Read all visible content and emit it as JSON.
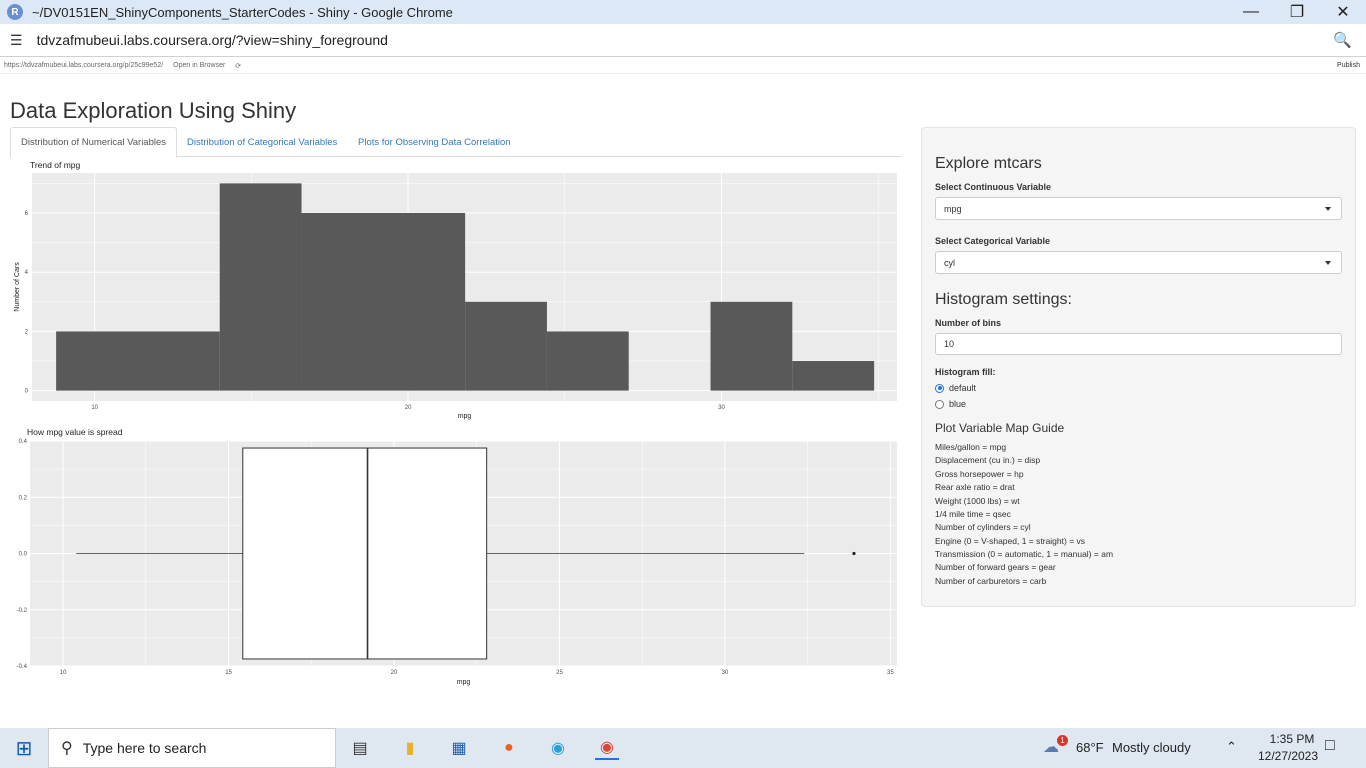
{
  "browser": {
    "window_title": "~/DV0151EN_ShinyComponents_StarterCodes - Shiny - Google Chrome",
    "url": "tdvzafmubeui.labs.coursera.org/?view=shiny_foreground",
    "rstudio_url": "https://tdvzafmubeui.labs.coursera.org/p/25c99e52/",
    "open_in_browser": "Open in Browser",
    "publish": "Publish"
  },
  "app": {
    "title": "Data Exploration Using Shiny",
    "tabs": [
      {
        "label": "Distribution of Numerical Variables",
        "active": true
      },
      {
        "label": "Distribution of Categorical Variables",
        "active": false
      },
      {
        "label": "Plots for Observing Data Correlation",
        "active": false
      }
    ]
  },
  "histogram": {
    "title": "Trend of mpg",
    "xlabel": "mpg",
    "ylabel": "Number of Cars",
    "x_ticks": [
      "10",
      "20",
      "30"
    ],
    "y_ticks": [
      "0",
      "2",
      "4",
      "6"
    ],
    "color": "#595959"
  },
  "boxplot": {
    "title": "How mpg value is spread",
    "xlabel": "mpg",
    "x_ticks": [
      "10",
      "15",
      "20",
      "25",
      "30",
      "35"
    ],
    "y_ticks": [
      "-0.4",
      "-0.2",
      "0.0",
      "0.2",
      "0.4"
    ]
  },
  "chart_data": [
    {
      "type": "bar",
      "title": "Trend of mpg",
      "xlabel": "mpg",
      "ylabel": "Number of Cars",
      "bins": [
        {
          "x0": 8.77,
          "x1": 13.99,
          "count": 2
        },
        {
          "x0": 13.99,
          "x1": 16.6,
          "count": 7
        },
        {
          "x0": 16.6,
          "x1": 21.82,
          "count": 6
        },
        {
          "x0": 21.82,
          "x1": 24.43,
          "count": 3
        },
        {
          "x0": 24.43,
          "x1": 27.04,
          "count": 2
        },
        {
          "x0": 27.04,
          "x1": 29.65,
          "count": 0
        },
        {
          "x0": 29.65,
          "x1": 32.26,
          "count": 3
        },
        {
          "x0": 32.26,
          "x1": 34.87,
          "count": 1
        }
      ],
      "xlim": [
        8.0,
        35.6
      ],
      "ylim": [
        -0.35,
        7.35
      ]
    },
    {
      "type": "box",
      "title": "How mpg value is spread",
      "xlabel": "mpg",
      "stats": {
        "whisker_low": 10.4,
        "q1": 15.43,
        "median": 19.2,
        "q3": 22.8,
        "whisker_high": 32.4,
        "outliers": [
          33.9
        ]
      },
      "xlim": [
        9.0,
        35.2
      ],
      "ylim": [
        -0.4,
        0.4
      ]
    }
  ],
  "sidebar": {
    "heading": "Explore mtcars",
    "continuous_label": "Select Continuous Variable",
    "continuous_value": "mpg",
    "categorical_label": "Select Categorical Variable",
    "categorical_value": "cyl",
    "hist_settings": "Histogram settings:",
    "bins_label": "Number of bins",
    "bins_value": "10",
    "fill_label": "Histogram fill:",
    "fill_options": [
      {
        "label": "default",
        "selected": true
      },
      {
        "label": "blue",
        "selected": false
      }
    ],
    "guide_heading": "Plot Variable Map Guide",
    "guide": [
      "Miles/gallon = mpg",
      "Displacement (cu in.) = disp",
      "Gross horsepower = hp",
      "Rear axle ratio = drat",
      "Weight (1000 lbs) = wt",
      "1/4 mile time = qsec",
      "Number of cylinders = cyl",
      "Engine (0 = V-shaped, 1 = straight) = vs",
      "Transmission (0 = automatic, 1 = manual) = am",
      "Number of forward gears = gear",
      "Number of carburetors = carb"
    ]
  },
  "taskbar": {
    "search_placeholder": "Type here to search",
    "weather_temp": "68°F",
    "weather_text": "Mostly cloudy",
    "weather_badge": "1",
    "time": "1:35 PM",
    "date": "12/27/2023"
  }
}
